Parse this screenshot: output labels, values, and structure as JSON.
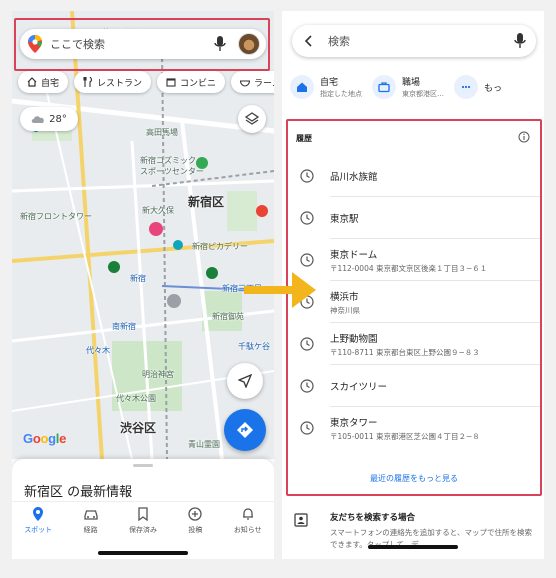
{
  "left": {
    "search": {
      "placeholder": "ここで検索"
    },
    "chips": [
      {
        "label": "自宅",
        "icon": "home-icon"
      },
      {
        "label": "レストラン",
        "icon": "restaurant-icon"
      },
      {
        "label": "コンビニ",
        "icon": "store-icon"
      },
      {
        "label": "ラーメ",
        "icon": "ramen-icon"
      }
    ],
    "weather": {
      "temp": "28°"
    },
    "map_labels": {
      "shinjuku_ku": "新宿区",
      "shibuya_ku": "渋谷区",
      "shinjuku": "新宿",
      "minami_shinjuku": "南新宿",
      "meiji_jingu": "明治神宮",
      "yoyogi_park": "代々木公園",
      "aoyama_cemetery": "青山霊園",
      "shinjuku_gyoen": "新宿御苑",
      "shinjuku_cosmic": "新宿コズミック\nスポーツセンター",
      "shinjuku_picadilly": "新宿ピカデリー",
      "shinjuku_front_tower": "新宿フロントタワー",
      "takadanobaba": "高田馬場",
      "shin_okubo": "新大久保",
      "sendagaya": "千駄ケ谷",
      "yoyogi": "代々木",
      "shinjuku_sanchome": "新宿三丁目"
    },
    "google": "Google",
    "sheet": {
      "title": "新宿区 の最新情報"
    },
    "nav": [
      {
        "label": "スポット",
        "icon": "pin-icon",
        "active": true
      },
      {
        "label": "経路",
        "icon": "car-icon",
        "active": false
      },
      {
        "label": "保存済み",
        "icon": "bookmark-icon",
        "active": false
      },
      {
        "label": "投稿",
        "icon": "plus-circle-icon",
        "active": false
      },
      {
        "label": "お知らせ",
        "icon": "bell-icon",
        "active": false
      }
    ]
  },
  "right": {
    "search": {
      "placeholder": "検索"
    },
    "quick": [
      {
        "title": "自宅",
        "subtitle": "指定した地点",
        "icon": "home-icon"
      },
      {
        "title": "職場",
        "subtitle": "東京都港区…",
        "icon": "briefcase-icon"
      },
      {
        "title": "もっ",
        "subtitle": "",
        "icon": "more-icon"
      }
    ],
    "history": {
      "header": "履歴",
      "items": [
        {
          "name": "品川水族館",
          "address": ""
        },
        {
          "name": "東京駅",
          "address": ""
        },
        {
          "name": "東京ドーム",
          "address": "〒112-0004 東京都文京区後楽１丁目３−６１"
        },
        {
          "name": "横浜市",
          "address": "神奈川県"
        },
        {
          "name": "上野動物園",
          "address": "〒110-8711 東京都台東区上野公園９−８３"
        },
        {
          "name": "スカイツリー",
          "address": ""
        },
        {
          "name": "東京タワー",
          "address": "〒105-0011 東京都港区芝公園４丁目２−８"
        }
      ],
      "more": "最近の履歴をもっと見る"
    },
    "friend": {
      "title": "友だちを検索する場合",
      "desc": "スマートフォンの連絡先を追加すると、マップで住所を検索できます。タップして、デ..."
    }
  },
  "colors": {
    "highlight": "#d9435a",
    "accent": "#1a73e8",
    "arrow": "#f2b51c"
  }
}
